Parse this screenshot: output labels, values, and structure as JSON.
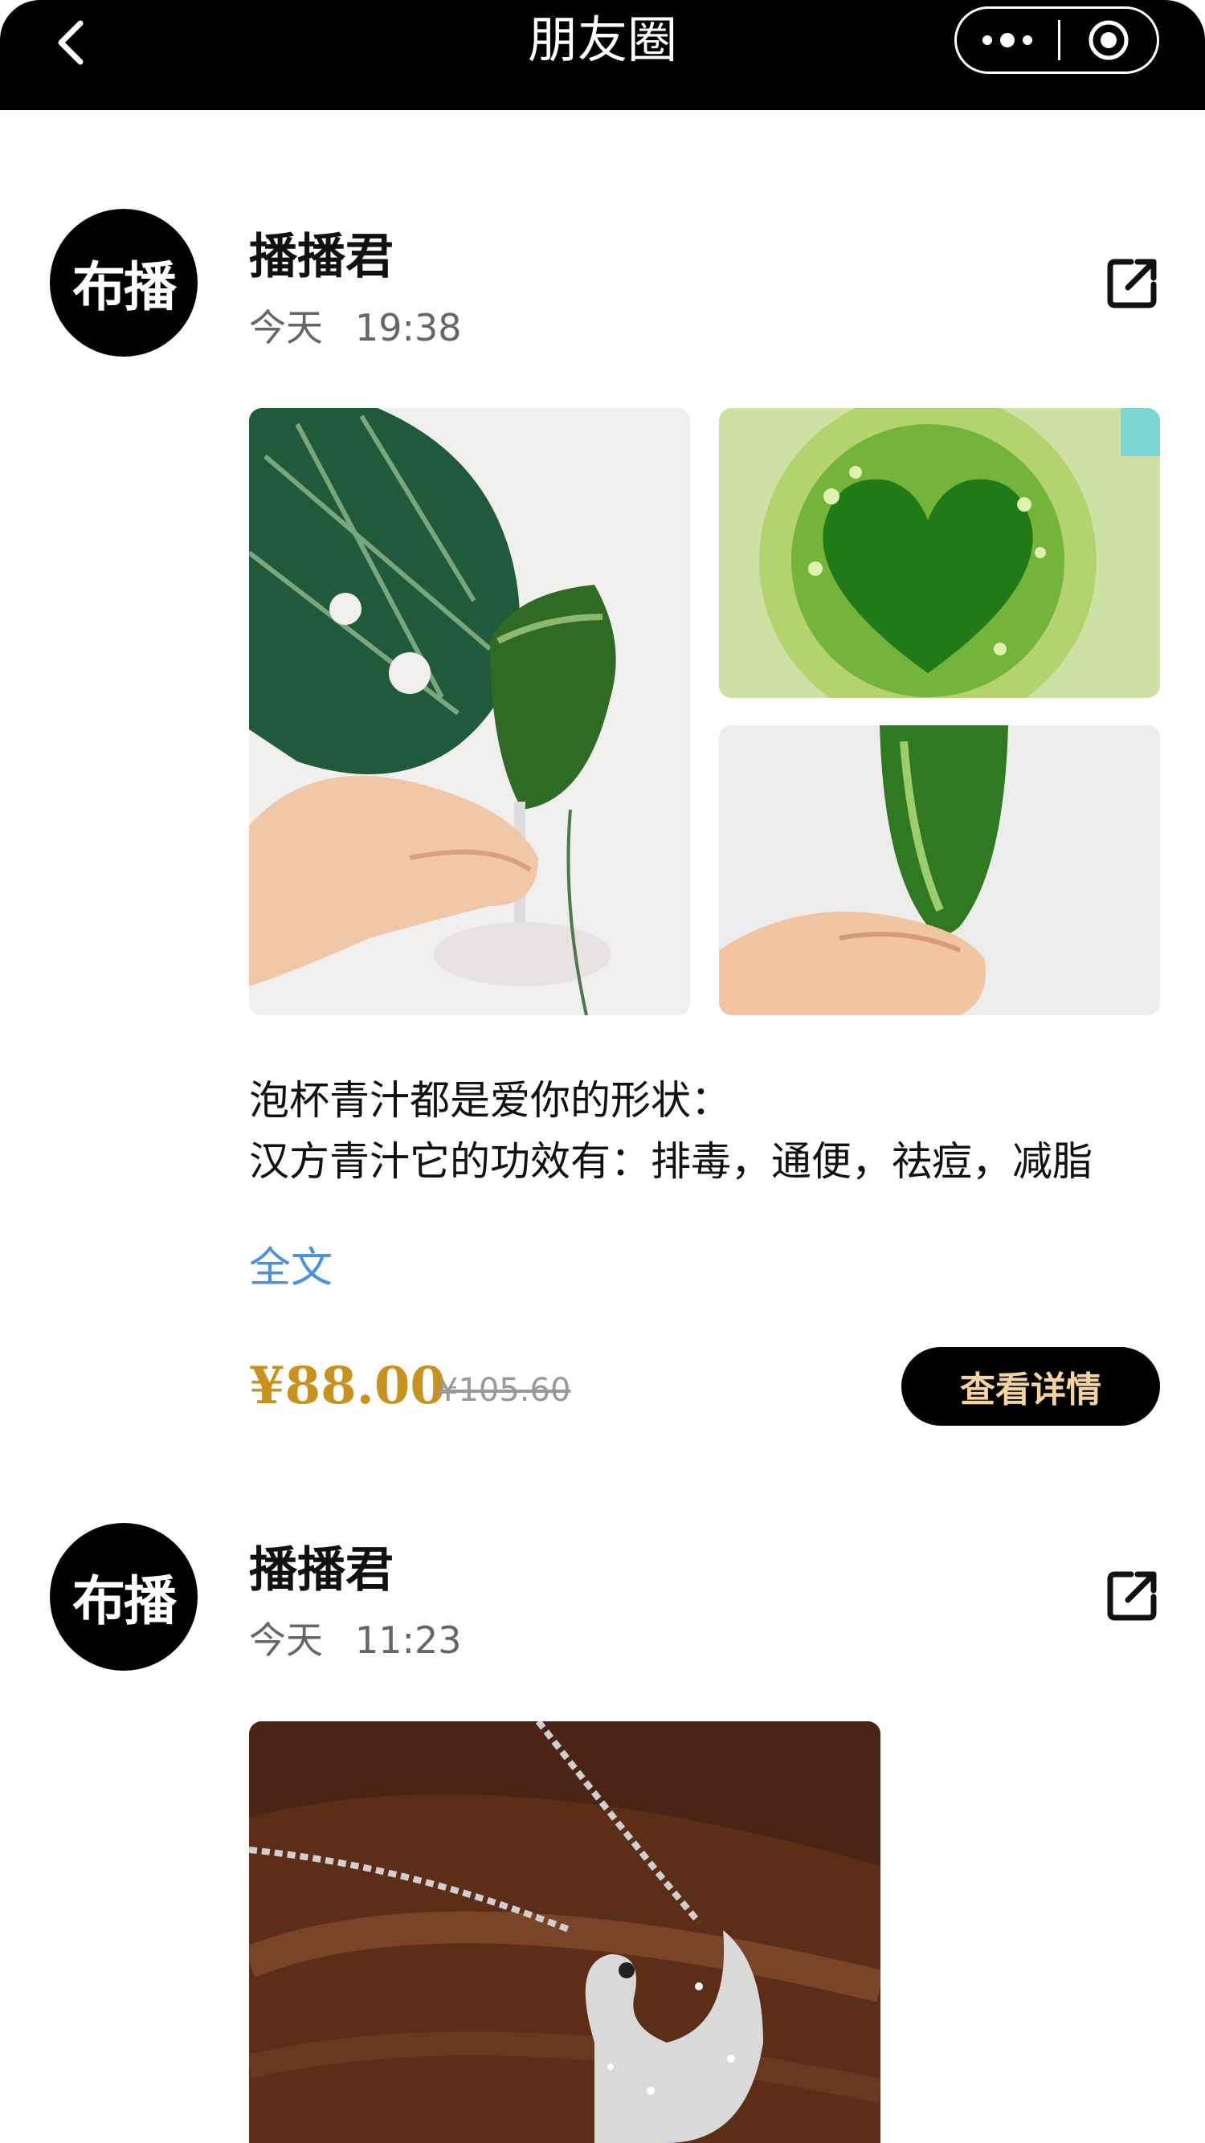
{
  "header": {
    "title": "朋友圈",
    "back_icon": "chevron-left-icon",
    "more_icon": "more-dots-icon",
    "record_icon": "target-icon"
  },
  "posts": [
    {
      "avatar_text": "布播",
      "username": "播播君",
      "day": "今天",
      "time": "19:38",
      "images": [
        {
          "description": "green juice in glass with monstera leaf"
        },
        {
          "description": "green juice heart shape top view"
        },
        {
          "description": "green juice glass held in hand"
        }
      ],
      "caption_lines": [
        "泡杯青汁都是爱你的形状：",
        "汉方青汁它的功效有：排毒，通便，祛痘，减脂"
      ],
      "full_text_label": "全文",
      "price": "¥88.00",
      "original_price": "¥105.60",
      "detail_button": "查看详情"
    },
    {
      "avatar_text": "布播",
      "username": "播播君",
      "day": "今天",
      "time": "11:23",
      "images": [
        {
          "description": "silver swan necklace on brown satin"
        }
      ]
    }
  ],
  "colors": {
    "accent_price": "#c8921e",
    "link_blue": "#4a90e2",
    "button_text": "#f3d4a1"
  }
}
